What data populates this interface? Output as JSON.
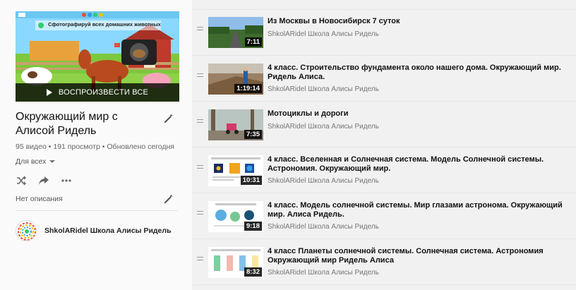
{
  "playlist": {
    "thumbnail_banner_text": "Сфотографируй всех домашних животных",
    "play_all_label": "ВОСПРОИЗВЕСТИ ВСЕ",
    "title": "Окружающий мир с Алисой Ридель",
    "stats": "95 видео • 191 просмотр • Обновлено сегодня",
    "privacy": "Для всех",
    "description": "Нет описания",
    "owner": "ShkolARidel Школа Алисы Ридель"
  },
  "icons": [
    "shuffle-icon",
    "share-icon",
    "more-icon",
    "pencil-icon",
    "drag-handle-icon"
  ],
  "videos": [
    {
      "title": "Из Москвы в Новосибирск 7 суток",
      "channel": "ShkolARidel Школа Алисы Ридель",
      "duration": "7:11"
    },
    {
      "title": "4 класс. Строительство фундамента около нашего дома. Окружающий мир. Ридель Алиса.",
      "channel": "ShkolARidel Школа Алисы Ридель",
      "duration": "1:19:14"
    },
    {
      "title": "Мотоциклы и дороги",
      "channel": "ShkolARidel Школа Алисы Ридель",
      "duration": "7:35"
    },
    {
      "title": "4 класс. Вселенная и Солнечная система. Модель Солнечной системы. Астрономия. Окружающий мир.",
      "channel": "ShkolARidel Школа Алисы Ридель",
      "duration": "10:31"
    },
    {
      "title": "4 класс. Модель солнечной системы. Мир глазами астронома. Окружающий мир. Алиса Ридель.",
      "channel": "ShkolARidel Школа Алисы Ридель",
      "duration": "9:18"
    },
    {
      "title": "4 класс Планеты солнечной системы. Солнечная система. Астрономия Окружающий мир Ридель Алиса",
      "channel": "ShkolARidel Школа Алисы Ридель",
      "duration": "8:32"
    }
  ]
}
